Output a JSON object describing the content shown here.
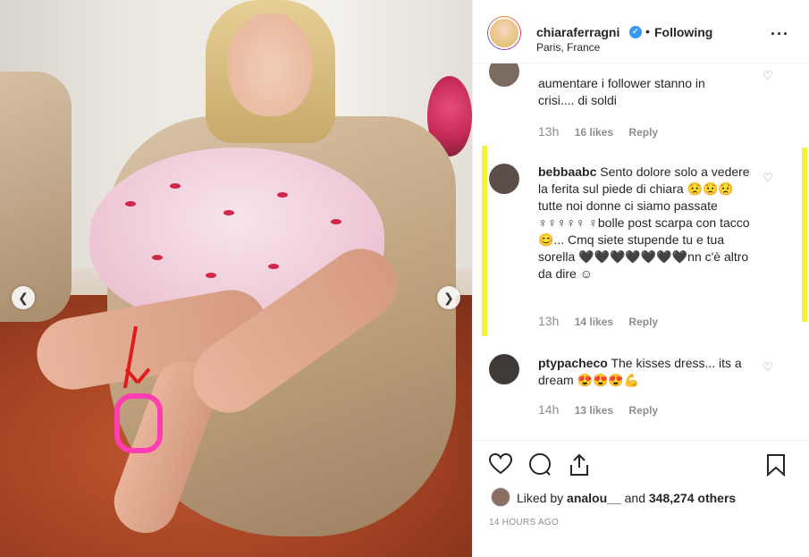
{
  "header": {
    "username": "chiaraferragni",
    "verified_icon": "verified-badge-icon",
    "separator": "•",
    "follow_status": "Following",
    "location": "Paris, France",
    "more_icon": "more-options-icon"
  },
  "photo": {
    "prev_icon": "chevron-left-icon",
    "next_icon": "chevron-right-icon"
  },
  "comments": [
    {
      "text_part1": "aumentare i follower stanno in",
      "text_part2": "crisi.... di soldi",
      "time": "13h",
      "likes": "16 likes",
      "reply": "Reply"
    },
    {
      "username": "bebbaabc",
      "text": "Sento dolore solo a vedere la ferita sul piede di chiara 😟😟😟tutte noi donne ci siamo passate ♀♀♀♀♀ ♀bolle post scarpa con tacco😊... Cmq siete stupende tu e tua sorella 🖤🖤🖤🖤🖤🖤🖤nn c'è altro da dire ☺",
      "time": "13h",
      "likes": "14 likes",
      "reply": "Reply"
    },
    {
      "username": "ptypacheco",
      "text": "The kisses dress... its a dream 😍😍😍💪",
      "time": "14h",
      "likes": "13 likes",
      "reply": "Reply"
    }
  ],
  "actions": {
    "like_icon": "heart-icon",
    "comment_icon": "comment-icon",
    "share_icon": "share-icon",
    "save_icon": "bookmark-icon",
    "liked_by_text": "Liked by",
    "liked_by_user": "analou__",
    "and_text": "and",
    "others": "348,274 others",
    "timestamp": "14 HOURS AGO"
  },
  "colors": {
    "highlight": "#f5f23a",
    "verified": "#3897f0",
    "shoe": "#ff3fb1"
  }
}
